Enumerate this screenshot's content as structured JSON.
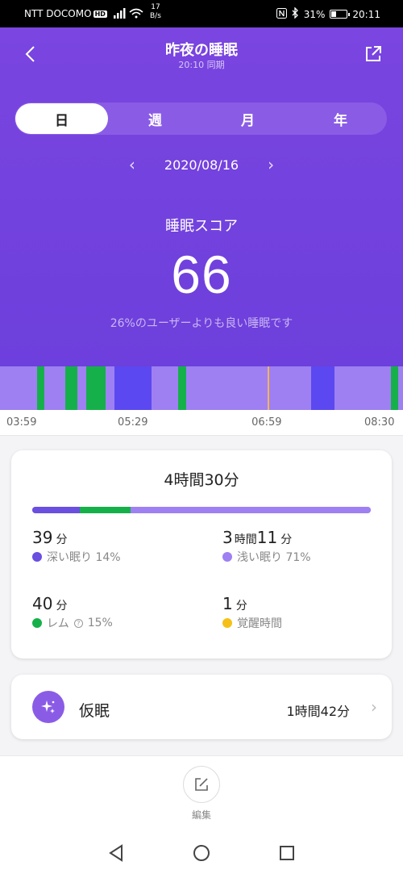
{
  "status_bar": {
    "carrier": "NTT DOCOMO",
    "carrier_badge": "HD",
    "net_speed_value": "17",
    "net_speed_unit": "B/s",
    "battery": "31%",
    "battery_level_percent": 31,
    "time": "20:11"
  },
  "header": {
    "title": "昨夜の睡眠",
    "sync_text": "20:10 同期"
  },
  "period_tabs": [
    {
      "label": "日",
      "active": true
    },
    {
      "label": "週",
      "active": false
    },
    {
      "label": "月",
      "active": false
    },
    {
      "label": "年",
      "active": false
    }
  ],
  "date_nav": {
    "prev": "‹",
    "date": "2020/08/16",
    "next": "›"
  },
  "score": {
    "label": "睡眠スコア",
    "value": "66",
    "description": "26%のユーザーよりも良い睡眠です"
  },
  "timeline": {
    "start": "03:59",
    "end": "08:30",
    "ticks": [
      "03:59",
      "05:29",
      "06:59",
      "08:30"
    ],
    "segments": [
      {
        "stage": "light",
        "from": "03:59",
        "to": "04:24"
      },
      {
        "stage": "rem",
        "from": "04:24",
        "to": "04:29"
      },
      {
        "stage": "light",
        "from": "04:29",
        "to": "04:43"
      },
      {
        "stage": "rem",
        "from": "04:43",
        "to": "04:51"
      },
      {
        "stage": "light",
        "from": "04:51",
        "to": "04:57"
      },
      {
        "stage": "rem",
        "from": "04:57",
        "to": "05:10"
      },
      {
        "stage": "light",
        "from": "05:10",
        "to": "05:16"
      },
      {
        "stage": "deep",
        "from": "05:16",
        "to": "05:41"
      },
      {
        "stage": "light",
        "from": "05:41",
        "to": "05:59"
      },
      {
        "stage": "rem",
        "from": "05:59",
        "to": "06:04"
      },
      {
        "stage": "light",
        "from": "06:04",
        "to": "07:28"
      },
      {
        "stage": "deep",
        "from": "07:28",
        "to": "07:44"
      },
      {
        "stage": "light",
        "from": "07:44",
        "to": "08:22"
      },
      {
        "stage": "rem",
        "from": "08:22",
        "to": "08:27"
      },
      {
        "stage": "light",
        "from": "08:27",
        "to": "08:30"
      }
    ],
    "marker_time": "06:59",
    "colors": {
      "light": "#9e80f2",
      "deep": "#5c48f0",
      "rem": "#16b04a",
      "marker": "#f4b55a"
    }
  },
  "summary": {
    "total": "4時間30分",
    "bar": [
      {
        "stage": "deep",
        "percent": 14,
        "color": "#6a4fe0"
      },
      {
        "stage": "rem",
        "percent": 15,
        "color": "#16b04a"
      },
      {
        "stage": "light",
        "percent": 71,
        "color": "#9e80f2"
      }
    ],
    "deep": {
      "value": "39",
      "unit": "分",
      "label": "深い眠り 14%",
      "color": "#6a4fe0"
    },
    "light": {
      "h": "3",
      "h_unit": "時間",
      "m": "11",
      "m_unit": "分",
      "label": "浅い眠り 71%",
      "color": "#9e80f2"
    },
    "rem": {
      "value": "40",
      "unit": "分",
      "label": "レム",
      "help": "?",
      "pct": "15%",
      "color": "#16b04a"
    },
    "awake": {
      "value": "1",
      "unit": "分",
      "label": "覚醒時間",
      "color": "#f5c118"
    }
  },
  "nap": {
    "label": "仮眠",
    "value": "1時間42分",
    "chevron": "›"
  },
  "bottom": {
    "edit_label": "編集"
  }
}
